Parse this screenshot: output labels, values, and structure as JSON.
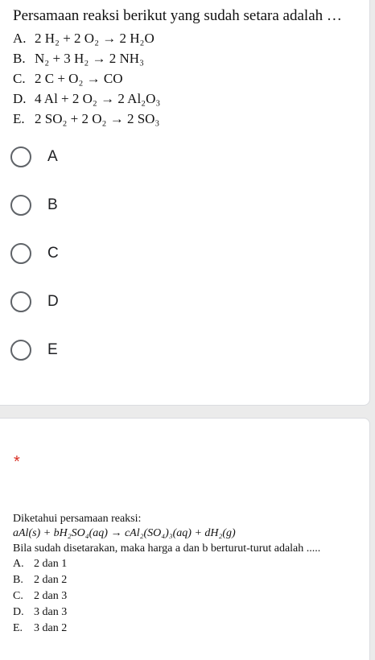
{
  "question1": {
    "title": "Persamaan reaksi berikut yang sudah setara adalah …",
    "options": [
      {
        "letter": "A.",
        "equation": "2 H₂ + 2 O₂ → 2 H₂O"
      },
      {
        "letter": "B.",
        "equation": "N₂ + 3 H₂ → 2 NH₃"
      },
      {
        "letter": "C.",
        "equation": "2 C + O₂ → CO"
      },
      {
        "letter": "D.",
        "equation": "4 Al + 2 O₂ → 2 Al₂O₃"
      },
      {
        "letter": "E.",
        "equation": "2 SO₂ + 2 O₂ → 2 SO₃"
      }
    ],
    "choices": [
      "A",
      "B",
      "C",
      "D",
      "E"
    ]
  },
  "question2": {
    "required_mark": "*",
    "intro": "Diketahui persamaan reaksi:",
    "equation": "aAl(s) + bH₂SO₄(aq) → cAl₂(SO₄)₃(aq) + dH₂(g)",
    "prompt": "Bila sudah disetarakan, maka harga a dan b berturut-turut adalah .....",
    "options": [
      {
        "letter": "A.",
        "text": "2 dan 1"
      },
      {
        "letter": "B.",
        "text": "2 dan 2"
      },
      {
        "letter": "C.",
        "text": "2 dan 3"
      },
      {
        "letter": "D.",
        "text": "3 dan 3"
      },
      {
        "letter": "E.",
        "text": "3 dan 2"
      }
    ]
  },
  "colors": {
    "required_star": "#d93025",
    "radio_border": "#5f6368",
    "page_bg": "#ebebeb"
  }
}
